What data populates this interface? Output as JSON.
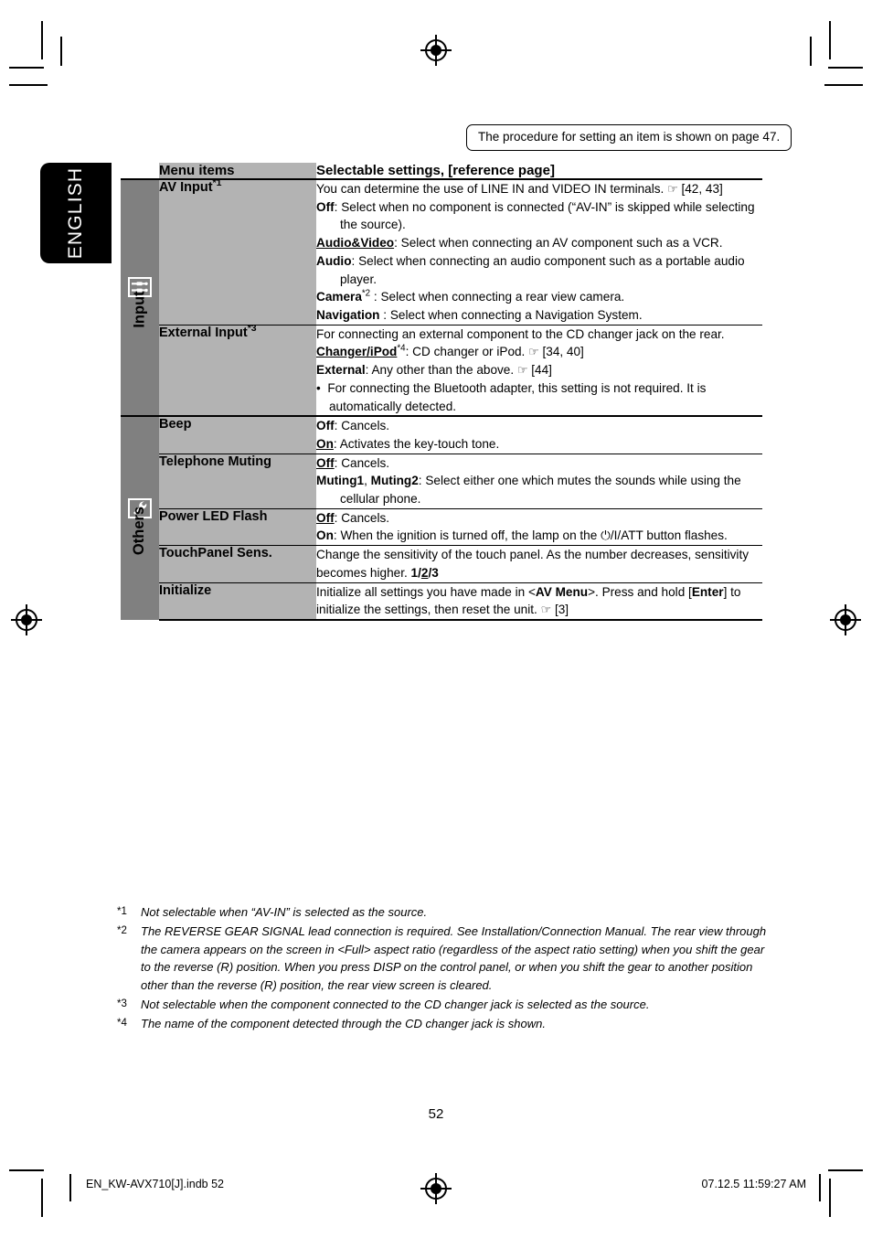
{
  "page_note": "The procedure for setting an item is shown on page 47.",
  "language_tab": "ENGLISH",
  "table": {
    "headers": {
      "menu_items": "Menu items",
      "settings": "Selectable settings, [reference page]"
    },
    "groups": [
      {
        "label": "Input",
        "icon": "av-jack-icon",
        "rows": [
          {
            "menu_item": "AV Input",
            "menu_item_sup": "*1",
            "lines": [
              "You can determine the use of LINE IN and VIDEO IN terminals. ☞ [42, 43]",
              "Off: Select when no component is connected (“AV-IN” is skipped while selecting the source).",
              "Audio&Video: Select when connecting an AV component such as a VCR.",
              "Audio: Select when connecting an audio component such as a portable audio player.",
              "Camera*2 : Select when connecting a rear view camera.",
              "Navigation : Select when connecting a Navigation System."
            ]
          },
          {
            "menu_item": "External Input",
            "menu_item_sup": "*3",
            "lines": [
              "For connecting an external component to the CD changer jack on the rear.",
              "Changer/iPod*4: CD changer or iPod. ☞ [34, 40]",
              "External: Any other than the above. ☞ [44]",
              "• For connecting the Bluetooth adapter, this setting is not required. It is automatically detected."
            ]
          }
        ]
      },
      {
        "label": "Others",
        "icon": "wrench-icon",
        "rows": [
          {
            "menu_item": "Beep",
            "menu_item_sup": "",
            "lines": [
              "Off: Cancels.",
              "On: Activates the key-touch tone."
            ]
          },
          {
            "menu_item": "Telephone Muting",
            "menu_item_sup": "",
            "lines": [
              "Off: Cancels.",
              "Muting1, Muting2: Select either one which mutes the sounds while using the cellular phone."
            ]
          },
          {
            "menu_item": "Power LED Flash",
            "menu_item_sup": "",
            "lines": [
              "Off: Cancels.",
              "On: When the ignition is turned off, the lamp on the ⏻/I/ATT button flashes."
            ]
          },
          {
            "menu_item": "TouchPanel Sens.",
            "menu_item_sup": "",
            "lines": [
              "Change the sensitivity of the touch panel. As the number decreases, sensitivity becomes higher. 1/2/3"
            ]
          },
          {
            "menu_item": "Initialize",
            "menu_item_sup": "",
            "lines": [
              "Initialize all settings you have made in <AV Menu>. Press and hold [Enter] to initialize the settings, then reset the unit. ☞ [3]"
            ]
          }
        ]
      }
    ]
  },
  "footnotes": [
    {
      "mark": "*1",
      "text": "Not selectable when “AV-IN” is selected as the source."
    },
    {
      "mark": "*2",
      "text": "The REVERSE GEAR SIGNAL lead connection is required. See Installation/Connection Manual. The rear view through the camera appears on the screen in <Full> aspect ratio (regardless of the aspect ratio setting) when you shift the gear to the reverse (R) position. When you press DISP on the control panel, or when you shift the gear to another position other than the reverse (R) position, the rear view screen is cleared."
    },
    {
      "mark": "*3",
      "text": "Not selectable when the component connected to the CD changer jack is selected as the source."
    },
    {
      "mark": "*4",
      "text": "The name of the component detected through the CD changer jack is shown."
    }
  ],
  "page_number": "52",
  "footer": {
    "left": "EN_KW-AVX710[J].indb   52",
    "right": "07.12.5   11:59:27 AM"
  },
  "colors": {
    "section_gray": "#808080",
    "menu_gray": "#b3b3b3",
    "tab_black": "#000000"
  }
}
